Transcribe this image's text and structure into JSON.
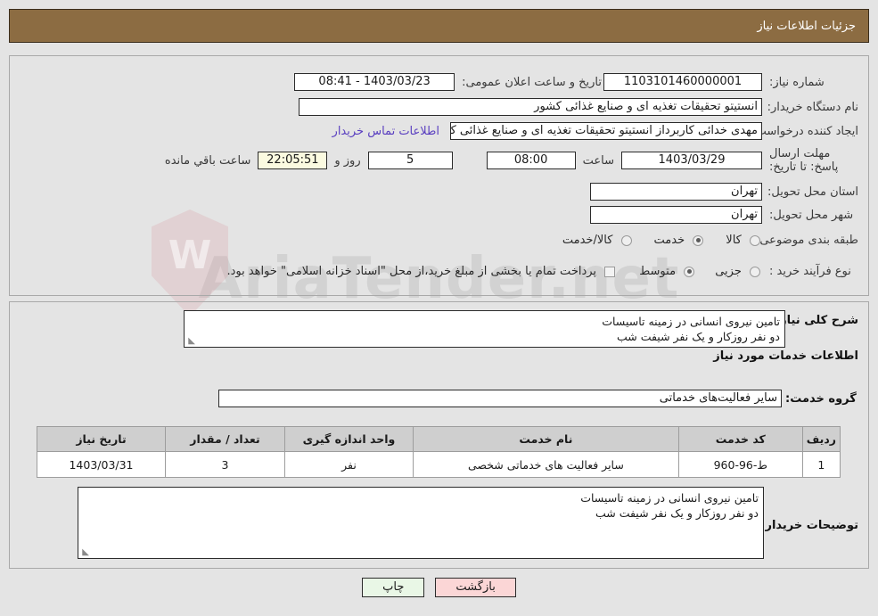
{
  "header": {
    "title": "جزئیات اطلاعات نیاز"
  },
  "watermark": {
    "text": "AriaTender.net"
  },
  "form": {
    "need_number": {
      "label": "شماره نیاز:",
      "value": "1103101460000001"
    },
    "announce_datetime": {
      "label": "تاریخ و ساعت اعلان عمومی:",
      "value": "1403/03/23 - 08:41"
    },
    "buyer_org": {
      "label": "نام دستگاه خریدار:",
      "value": "انستیتو تحقیقات تغذیه ای و صنایع غذائی کشور"
    },
    "requester": {
      "label": "ایجاد کننده درخواست:",
      "value": "مهدی خدائی کاربرداز انستیتو تحقیقات تغذیه ای و صنایع غذائی کشور"
    },
    "contact_link": {
      "label": "اطلاعات تماس خریدار"
    },
    "deadline": {
      "label": "مهلت ارسال پاسخ: تا تاریخ:",
      "date": "1403/03/29",
      "hour_label": "ساعت",
      "hour": "08:00",
      "days": "5",
      "days_label": "روز و",
      "countdown": "22:05:51",
      "remaining_label": "ساعت باقي مانده"
    },
    "province": {
      "label": "استان محل تحویل:",
      "value": "تهران"
    },
    "city": {
      "label": "شهر محل تحویل:",
      "value": "تهران"
    },
    "category": {
      "label": "طبقه بندی موضوعی:",
      "options": [
        {
          "label": "کالا",
          "selected": false
        },
        {
          "label": "خدمت",
          "selected": true
        },
        {
          "label": "کالا/خدمت",
          "selected": false
        }
      ]
    },
    "purchase_type": {
      "label": "نوع فرآیند خرید :",
      "options": [
        {
          "label": "جزیی",
          "selected": false
        },
        {
          "label": "متوسط",
          "selected": true
        }
      ],
      "treasury_checkbox": {
        "checked": false,
        "label": "پرداخت تمام یا بخشی از مبلغ خرید،از محل \"اسناد خزانه اسلامی\" خواهد بود."
      }
    },
    "general_description": {
      "label": "شرح کلی نیاز:",
      "lines": [
        "تامین نیروی انسانی در زمینه تاسیسات",
        "دو نفر روزکار و یک نفر شیفت شب"
      ]
    },
    "services_section_title": "اطلاعات خدمات مورد نیاز",
    "service_group": {
      "label": "گروه خدمت:",
      "value": "سایر فعالیت‌های خدماتی"
    },
    "buyer_notes": {
      "label": "توضیحات خریدار:",
      "lines": [
        "تامین نیروی انسانی در زمینه تاسیسات",
        "دو نفر روزکار و یک نفر شیفت شب"
      ]
    }
  },
  "items_table": {
    "columns": [
      "ردیف",
      "کد خدمت",
      "نام خدمت",
      "واحد اندازه گیری",
      "تعداد / مقدار",
      "تاریخ نیاز"
    ],
    "rows": [
      {
        "index": "1",
        "code": "ط-96-960",
        "name": "سایر فعالیت های خدماتی شخصی",
        "unit": "نفر",
        "quantity": "3",
        "need_date": "1403/03/31"
      }
    ]
  },
  "buttons": {
    "print": "چاپ",
    "back": "بازگشت"
  }
}
